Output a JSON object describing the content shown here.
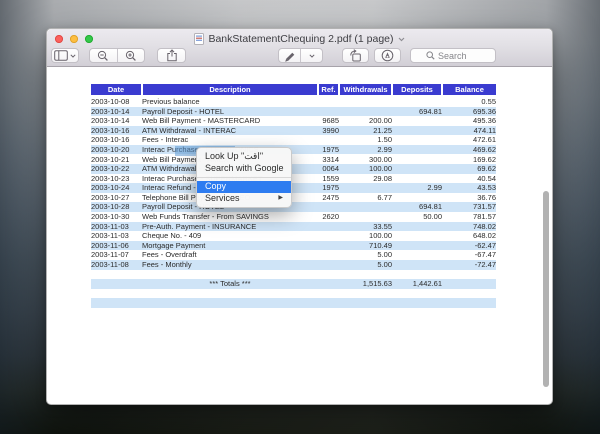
{
  "window": {
    "title": "BankStatementChequing 2.pdf (1 page)",
    "toolbar": {
      "search_placeholder": "Search"
    }
  },
  "context_menu": {
    "items": [
      {
        "label": "Look Up \"اقت\""
      },
      {
        "label": "Search with Google"
      },
      {
        "separator": true
      },
      {
        "label": "Copy",
        "highlighted": true
      },
      {
        "label": "Services",
        "submenu": true
      }
    ]
  },
  "statement": {
    "columns": [
      "Date",
      "Description",
      "Ref.",
      "Withdrawals",
      "Deposits",
      "Balance"
    ],
    "rows": [
      {
        "date": "2003-10-08",
        "desc": "Previous balance",
        "ref": "",
        "wd": "",
        "dep": "",
        "bal": "0.55"
      },
      {
        "date": "2003-10-14",
        "desc": "Payroll Deposit - HOTEL",
        "ref": "",
        "wd": "",
        "dep": "694.81",
        "bal": "695.36"
      },
      {
        "date": "2003-10-14",
        "desc": "Web Bill Payment - MASTERCARD",
        "ref": "9685",
        "wd": "200.00",
        "dep": "",
        "bal": "495.36"
      },
      {
        "date": "2003-10-16",
        "desc": "ATM Withdrawal - INTERAC",
        "ref": "3990",
        "wd": "21.25",
        "dep": "",
        "bal": "474.11"
      },
      {
        "date": "2003-10-16",
        "desc": "Fees - Interac",
        "ref": "",
        "wd": "1.50",
        "dep": "",
        "bal": "472.61"
      },
      {
        "date": "2003-10-20",
        "desc": "Interac Purchase - ELECTRONICS",
        "ref": "1975",
        "wd": "2.99",
        "dep": "",
        "bal": "469.62",
        "selected": true
      },
      {
        "date": "2003-10-21",
        "desc": "Web Bill Payment - AMEX",
        "ref": "3314",
        "wd": "300.00",
        "dep": "",
        "bal": "169.62"
      },
      {
        "date": "2003-10-22",
        "desc": "ATM Withdrawal - FIRST BANK",
        "ref": "0064",
        "wd": "100.00",
        "dep": "",
        "bal": "69.62"
      },
      {
        "date": "2003-10-23",
        "desc": "Interac Purchase - SUPERMARKET",
        "ref": "1559",
        "wd": "29.08",
        "dep": "",
        "bal": "40.54"
      },
      {
        "date": "2003-10-24",
        "desc": "Interac Refund - ELECTRONICS",
        "ref": "1975",
        "wd": "",
        "dep": "2.99",
        "bal": "43.53"
      },
      {
        "date": "2003-10-27",
        "desc": "Telephone Bill Payment - VIDEO",
        "ref": "2475",
        "wd": "6.77",
        "dep": "",
        "bal": "36.76"
      },
      {
        "date": "2003-10-28",
        "desc": "Payroll Deposit - HOTEL",
        "ref": "",
        "wd": "",
        "dep": "694.81",
        "bal": "731.57"
      },
      {
        "date": "2003-10-30",
        "desc": "Web Funds Transfer - From  SAVINGS",
        "ref": "2620",
        "wd": "",
        "dep": "50.00",
        "bal": "781.57"
      },
      {
        "date": "2003-11-03",
        "desc": "Pre-Auth. Payment - INSURANCE",
        "ref": "",
        "wd": "33.55",
        "dep": "",
        "bal": "748.02"
      },
      {
        "date": "2003-11-03",
        "desc": "Cheque No. - 409",
        "ref": "",
        "wd": "100.00",
        "dep": "",
        "bal": "648.02"
      },
      {
        "date": "2003-11-06",
        "desc": "Mortgage Payment",
        "ref": "",
        "wd": "710.49",
        "dep": "",
        "bal": "-62.47"
      },
      {
        "date": "2003-11-07",
        "desc": "Fees - Overdraft",
        "ref": "",
        "wd": "5.00",
        "dep": "",
        "bal": "-67.47"
      },
      {
        "date": "2003-11-08",
        "desc": "Fees - Monthly",
        "ref": "",
        "wd": "5.00",
        "dep": "",
        "bal": "-72.47"
      },
      {
        "type": "blank"
      },
      {
        "type": "totals",
        "desc": "*** Totals ***",
        "wd": "1,515.63",
        "dep": "1,442.61"
      },
      {
        "type": "blank"
      },
      {
        "type": "blank"
      }
    ]
  },
  "colors": {
    "header_bg": "#3a3bd0",
    "row_stripe": "#cfe4f7",
    "menu_highlight": "#2e7cf0",
    "text_selection": "#5f9ad6"
  }
}
